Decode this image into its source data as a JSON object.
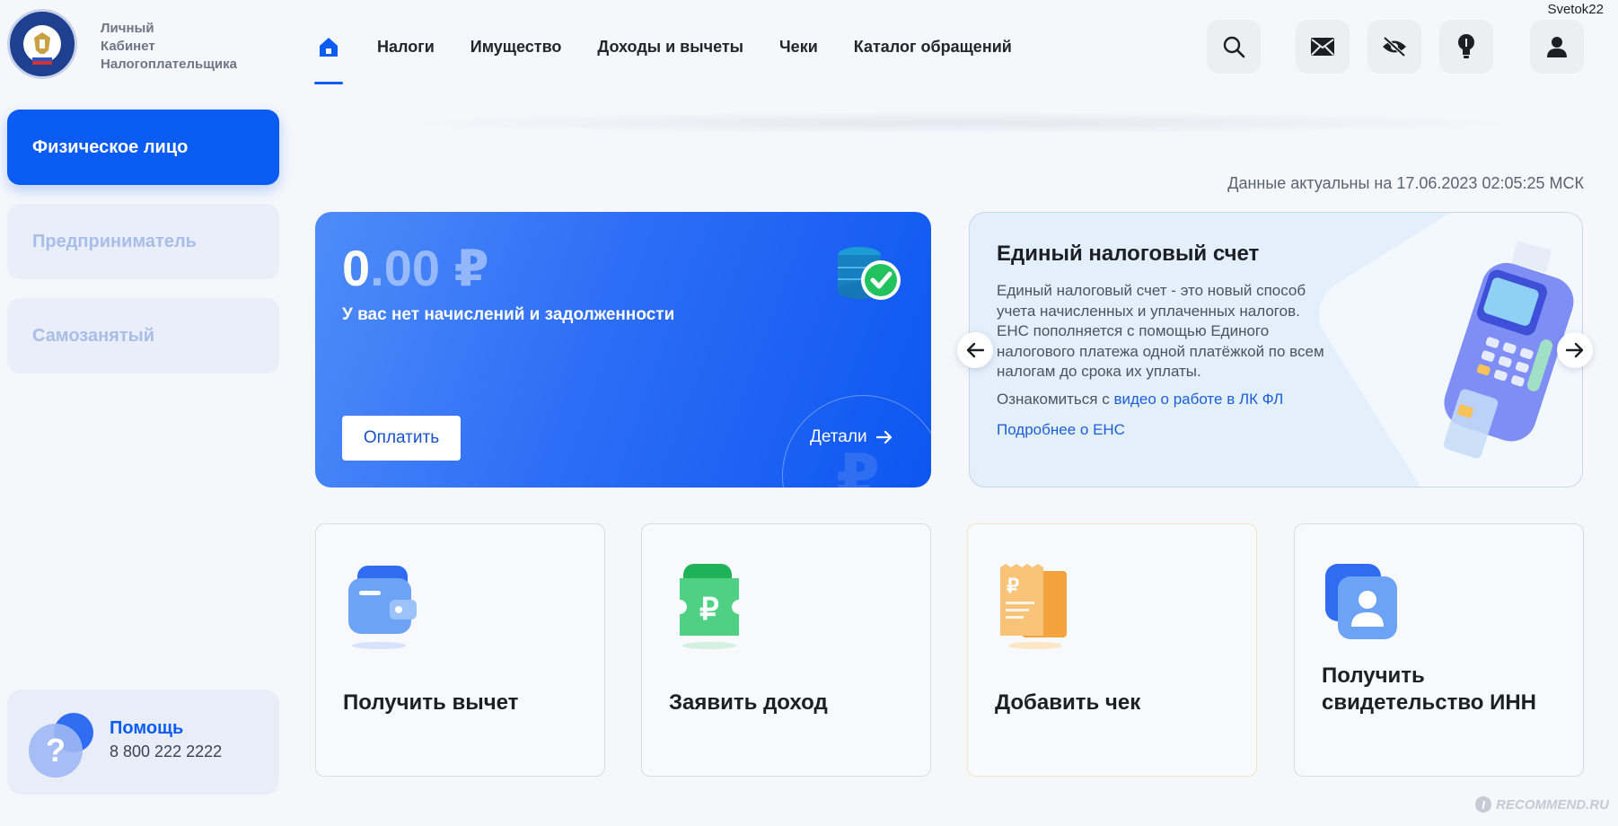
{
  "header": {
    "logo_lines": [
      "Личный",
      "Кабинет",
      "Налогоплательщика"
    ],
    "user": "Svetok22",
    "nav": [
      "Налоги",
      "Имущество",
      "Доходы и вычеты",
      "Чеки",
      "Каталог обращений"
    ],
    "icons": [
      "home-icon",
      "search-icon",
      "mail-icon",
      "eye-off-icon",
      "lightbulb-icon",
      "user-icon"
    ]
  },
  "sidebar": {
    "items": [
      {
        "label": "Физическое лицо",
        "active": true
      },
      {
        "label": "Предприниматель",
        "active": false
      },
      {
        "label": "Самозанятый",
        "active": false
      }
    ],
    "help": {
      "title": "Помощь",
      "phone": "8 800 222 2222"
    }
  },
  "main": {
    "updated": "Данные актуальны на 17.06.2023 02:05:25 МСК",
    "balance": {
      "amount_int": "0",
      "amount_dec": ".00 ₽",
      "subtitle": "У вас нет начислений и задолженности",
      "pay_label": "Оплатить",
      "details_label": "Детали"
    },
    "ens": {
      "title": "Единый налоговый счет",
      "description": "Единый налоговый счет - это новый способ учета начисленных и уплаченных налогов. ЕНС пополняется с помощью Единого налогового платежа одной платёжкой по всем налогам до срока их уплаты.",
      "video_prefix": "Ознакомиться с",
      "video_link": "видео о работе в ЛК ФЛ",
      "more_link": "Подробнее о ЕНС"
    },
    "tiles": [
      {
        "title": "Получить вычет"
      },
      {
        "title": "Заявить доход"
      },
      {
        "title": "Добавить чек"
      },
      {
        "title": "Получить свидетельство ИНН"
      }
    ]
  },
  "watermark": "RECOMMEND.RU",
  "colors": {
    "accent": "#0a5cf5",
    "inactive_bg": "#e9eef9",
    "inactive_text": "#a8bde8"
  }
}
